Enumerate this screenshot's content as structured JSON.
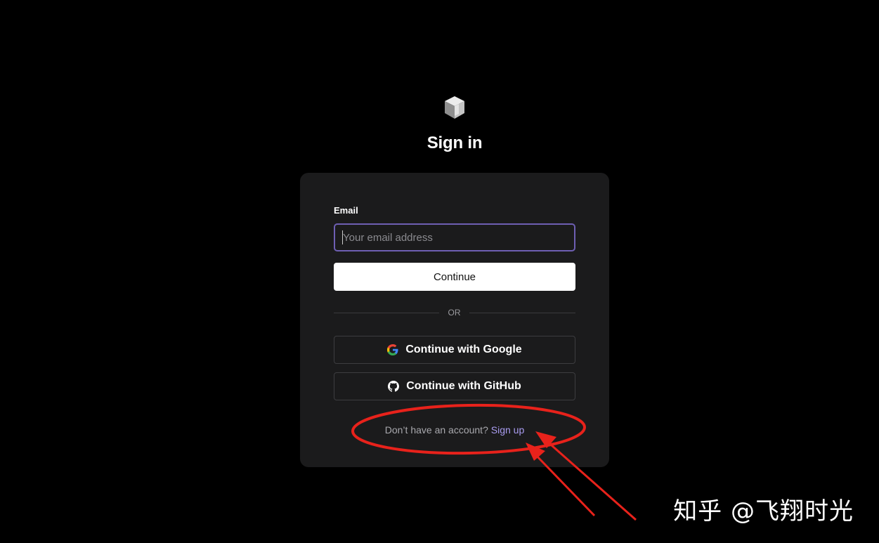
{
  "header": {
    "logo_icon": "cube-logo-icon",
    "title": "Sign in"
  },
  "form": {
    "email_label": "Email",
    "email_placeholder": "Your email address",
    "email_value": "",
    "continue_label": "Continue",
    "divider_text": "OR",
    "google_label": "Continue with Google",
    "google_icon": "google-icon",
    "github_label": "Continue with GitHub",
    "github_icon": "github-icon",
    "signup_prompt": "Don’t have an account?",
    "signup_link": "Sign up"
  },
  "colors": {
    "background": "#000000",
    "card": "#1b1b1c",
    "input_focus_border": "#6e5fb3",
    "link": "#a99cf0",
    "annotation": "#e8221b"
  },
  "watermark": {
    "text": "知乎 @飞翔时光"
  }
}
